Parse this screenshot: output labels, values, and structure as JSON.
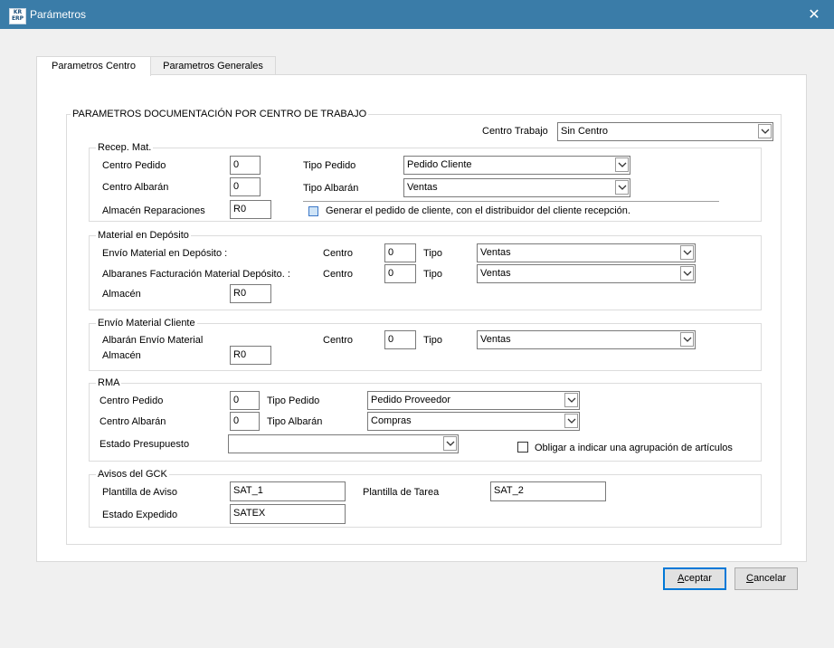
{
  "window": {
    "title": "Parámetros",
    "icon_text_top": "KR",
    "icon_text_bottom": "ERP",
    "close_glyph": "✕"
  },
  "tabs": [
    {
      "label": "Parametros Centro",
      "active": true
    },
    {
      "label": "Parametros Generales",
      "active": false
    }
  ],
  "main": {
    "legend": "PARAMETROS DOCUMENTACIÓN POR CENTRO DE TRABAJO",
    "centro_trabajo_label": "Centro Trabajo",
    "centro_trabajo_value": "Sin Centro"
  },
  "recep": {
    "legend": "Recep. Mat.",
    "centro_pedido_label": "Centro Pedido",
    "centro_pedido_value": "0",
    "tipo_pedido_label": "Tipo Pedido",
    "tipo_pedido_value": "Pedido Cliente",
    "centro_albaran_label": "Centro Albarán",
    "centro_albaran_value": "0",
    "tipo_albaran_label": "Tipo Albarán",
    "tipo_albaran_value": "Ventas",
    "almacen_label": "Almacén Reparaciones",
    "almacen_value": "R0",
    "generar_label": "Generar el pedido de cliente, con el distribuidor del cliente recepción.",
    "generar_checked": false
  },
  "deposito": {
    "legend": "Material en Depósito",
    "envio_label": "Envío Material en Depósito :",
    "albaranes_label": "Albaranes Facturación Material Depósito. :",
    "centro_label": "Centro",
    "tipo_label": "Tipo",
    "envio_centro_value": "0",
    "envio_tipo_value": "Ventas",
    "albaranes_centro_value": "0",
    "albaranes_tipo_value": "Ventas",
    "almacen_label": "Almacén",
    "almacen_value": "R0"
  },
  "envio_cliente": {
    "legend": "Envío Material Cliente",
    "albaran_label": "Albarán Envío Material",
    "centro_label": "Centro",
    "centro_value": "0",
    "tipo_label": "Tipo",
    "tipo_value": "Ventas",
    "almacen_label": "Almacén",
    "almacen_value": "R0"
  },
  "rma": {
    "legend": "RMA",
    "centro_pedido_label": "Centro Pedido",
    "centro_pedido_value": "0",
    "tipo_pedido_label": "Tipo Pedido",
    "tipo_pedido_value": "Pedido Proveedor",
    "centro_albaran_label": "Centro Albarán",
    "centro_albaran_value": "0",
    "tipo_albaran_label": "Tipo Albarán",
    "tipo_albaran_value": "Compras",
    "estado_label": "Estado Presupuesto",
    "estado_value": "",
    "obligar_label": "Obligar a indicar una agrupación de artículos",
    "obligar_checked": false
  },
  "avisos": {
    "legend": "Avisos del GCK",
    "plantilla_aviso_label": "Plantilla de Aviso",
    "plantilla_aviso_value": "SAT_1",
    "plantilla_tarea_label": "Plantilla de Tarea",
    "plantilla_tarea_value": "SAT_2",
    "estado_expedido_label": "Estado Expedido",
    "estado_expedido_value": "SATEX"
  },
  "buttons": {
    "aceptar_mnemonic": "A",
    "aceptar_rest": "ceptar",
    "cancelar_mnemonic": "C",
    "cancelar_rest": "ancelar"
  },
  "colors": {
    "titlebar": "#3a7ca8",
    "accent_focus": "#0078d7",
    "background": "#f0f0f0"
  }
}
